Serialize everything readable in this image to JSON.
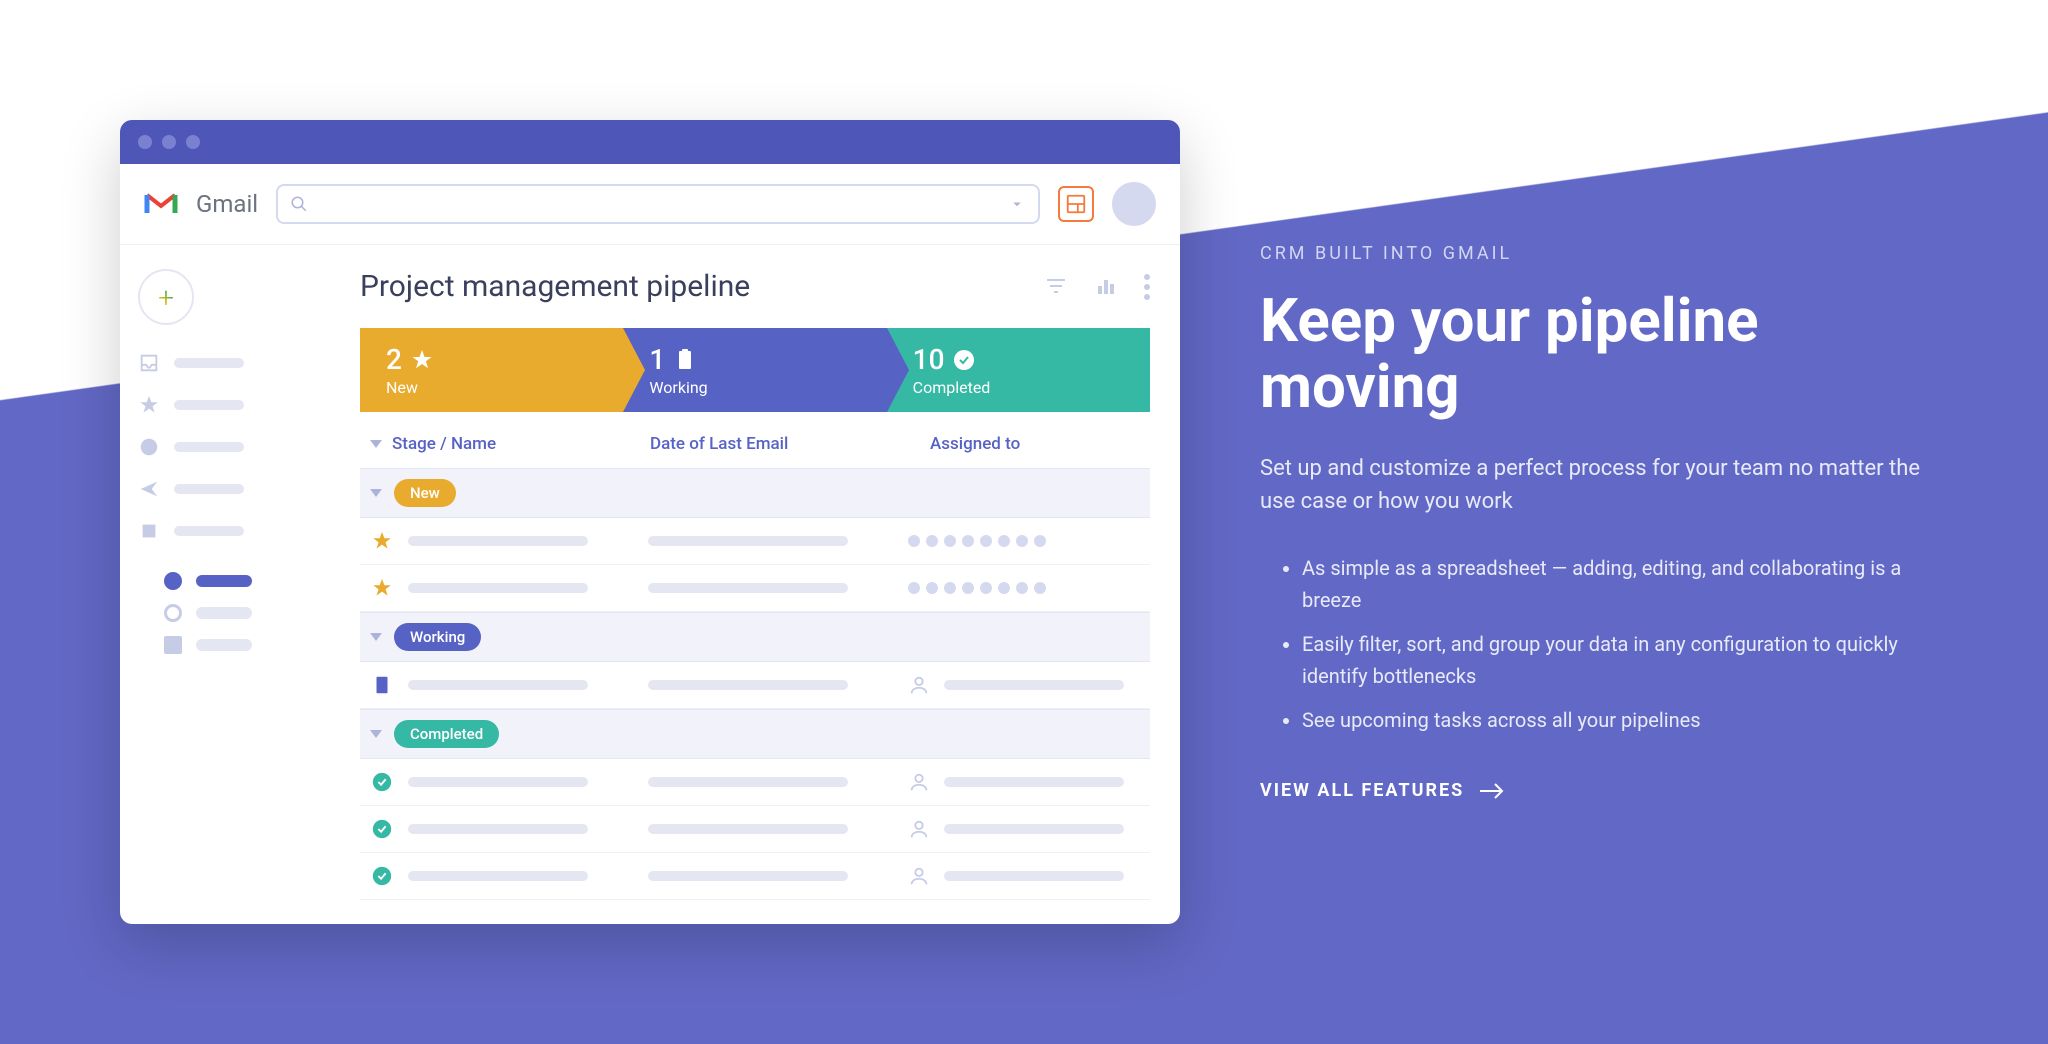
{
  "brand": "Gmail",
  "main": {
    "title": "Project management pipeline",
    "columns": {
      "stage": "Stage / Name",
      "date": "Date of Last Email",
      "assigned": "Assigned to"
    },
    "stages": [
      {
        "count": "2",
        "label": "New"
      },
      {
        "count": "1",
        "label": "Working"
      },
      {
        "count": "10",
        "label": "Completed"
      }
    ],
    "groups": {
      "new": "New",
      "working": "Working",
      "completed": "Completed"
    }
  },
  "copy": {
    "eyebrow": "CRM BUILT INTO GMAIL",
    "headline": "Keep your pipeline moving",
    "sub": "Set up and customize a perfect process for your team no matter the use case or how you work",
    "bullets": [
      "As simple as a spreadsheet — adding, editing, and collaborating is a breeze",
      "Easily filter, sort, and group your data in any configuration to quickly identify bottlenecks",
      "See upcoming tasks across all your pipelines"
    ],
    "cta": "VIEW ALL FEATURES"
  }
}
